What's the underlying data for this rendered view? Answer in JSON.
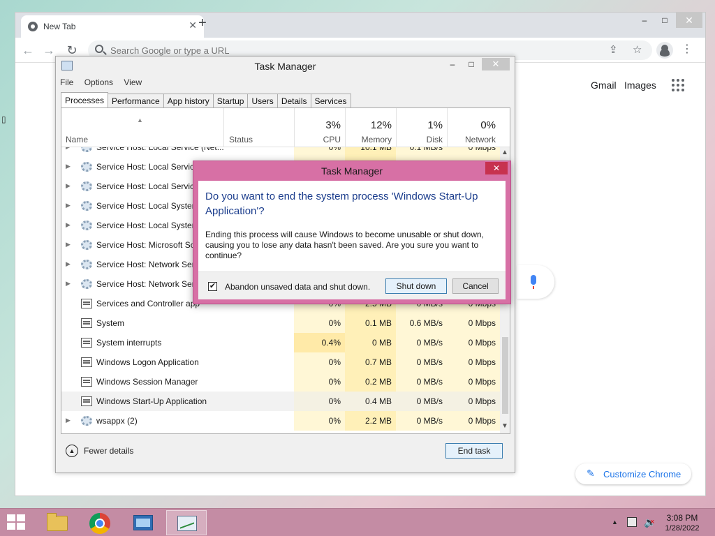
{
  "browser": {
    "tab_title": "New Tab",
    "tab_close": "✕",
    "new_tab": "+",
    "omnibox_placeholder": "Search Google or type a URL",
    "gmail": "Gmail",
    "images": "Images",
    "customize_label": "Customize Chrome",
    "window_controls": {
      "minimize": "–",
      "maximize": "□",
      "close": "✕"
    }
  },
  "task_manager": {
    "title": "Task Manager",
    "window_controls": {
      "minimize": "–",
      "maximize": "□",
      "close": "✕"
    },
    "menu": [
      "File",
      "Options",
      "View"
    ],
    "tabs": [
      "Processes",
      "Performance",
      "App history",
      "Startup",
      "Users",
      "Details",
      "Services"
    ],
    "active_tab": "Processes",
    "columns": {
      "name": "Name",
      "status": "Status",
      "cpu": {
        "percent": "3%",
        "label": "CPU"
      },
      "memory": {
        "percent": "12%",
        "label": "Memory"
      },
      "disk": {
        "percent": "1%",
        "label": "Disk"
      },
      "network": {
        "percent": "0%",
        "label": "Network"
      }
    },
    "processes": [
      {
        "name": "Service Host: Local Service (Net...",
        "expandable": true,
        "icon": "gear-icon",
        "cpu": "0%",
        "memory": "10.1 MB",
        "disk": "0.1 MB/s",
        "network": "0 Mbps"
      },
      {
        "name": "Service Host: Local Service",
        "expandable": true,
        "icon": "gear-icon",
        "cpu": "",
        "memory": "",
        "disk": "",
        "network": ""
      },
      {
        "name": "Service Host: Local Service",
        "expandable": true,
        "icon": "gear-icon",
        "cpu": "",
        "memory": "",
        "disk": "",
        "network": ""
      },
      {
        "name": "Service Host: Local System",
        "expandable": true,
        "icon": "gear-icon",
        "cpu": "",
        "memory": "",
        "disk": "",
        "network": ""
      },
      {
        "name": "Service Host: Local System",
        "expandable": true,
        "icon": "gear-icon",
        "cpu": "",
        "memory": "",
        "disk": "",
        "network": ""
      },
      {
        "name": "Service Host: Microsoft So",
        "expandable": true,
        "icon": "gear-icon",
        "cpu": "",
        "memory": "",
        "disk": "",
        "network": ""
      },
      {
        "name": "Service Host: Network Serv",
        "expandable": true,
        "icon": "gear-icon",
        "cpu": "",
        "memory": "",
        "disk": "",
        "network": ""
      },
      {
        "name": "Service Host: Network Serv",
        "expandable": true,
        "icon": "gear-icon",
        "cpu": "",
        "memory": "",
        "disk": "",
        "network": ""
      },
      {
        "name": "Services and Controller app",
        "expandable": false,
        "icon": "app-window-icon",
        "cpu": "0%",
        "memory": "2.5 MB",
        "disk": "0 MB/s",
        "network": "0 Mbps"
      },
      {
        "name": "System",
        "expandable": false,
        "icon": "app-window-icon",
        "cpu": "0%",
        "memory": "0.1 MB",
        "disk": "0.6 MB/s",
        "network": "0 Mbps"
      },
      {
        "name": "System interrupts",
        "expandable": false,
        "icon": "app-window-icon",
        "cpu": "0.4%",
        "memory": "0 MB",
        "disk": "0 MB/s",
        "network": "0 Mbps"
      },
      {
        "name": "Windows Logon Application",
        "expandable": false,
        "icon": "app-window-icon",
        "cpu": "0%",
        "memory": "0.7 MB",
        "disk": "0 MB/s",
        "network": "0 Mbps"
      },
      {
        "name": "Windows Session Manager",
        "expandable": false,
        "icon": "app-window-icon",
        "cpu": "0%",
        "memory": "0.2 MB",
        "disk": "0 MB/s",
        "network": "0 Mbps"
      },
      {
        "name": "Windows Start-Up Application",
        "expandable": false,
        "icon": "app-window-icon",
        "cpu": "0%",
        "memory": "0.4 MB",
        "disk": "0 MB/s",
        "network": "0 Mbps",
        "highlighted": true
      },
      {
        "name": "wsappx (2)",
        "expandable": true,
        "icon": "gear-icon",
        "cpu": "0%",
        "memory": "2.2 MB",
        "disk": "0 MB/s",
        "network": "0 Mbps"
      }
    ],
    "fewer_details": "Fewer details",
    "end_task": "End task"
  },
  "dialog": {
    "title": "Task Manager",
    "close": "✕",
    "heading": "Do you want to end the system process 'Windows Start-Up Application'?",
    "message": "Ending this process will cause Windows to become unusable or shut down, causing you to lose any data hasn't been saved. Are you sure you want to continue?",
    "checkbox_label": "Abandon unsaved data and shut down.",
    "checkbox_checked": true,
    "checkmark": "✔",
    "shutdown_label": "Shut down",
    "cancel_label": "Cancel"
  },
  "taskbar": {
    "apps": [
      "file-explorer-icon",
      "chrome-icon",
      "control-panel-icon",
      "task-manager-icon"
    ],
    "active_app": "task-manager-icon",
    "time": "3:08 PM",
    "date": "1/28/2022"
  },
  "colors": {
    "dialog_frame": "#d770a5",
    "dialog_heading": "#1a3c8c",
    "taskbar": "#c48ca4",
    "cell_highlight": "#fff7d6",
    "chrome_accent": "#1a73e8"
  }
}
